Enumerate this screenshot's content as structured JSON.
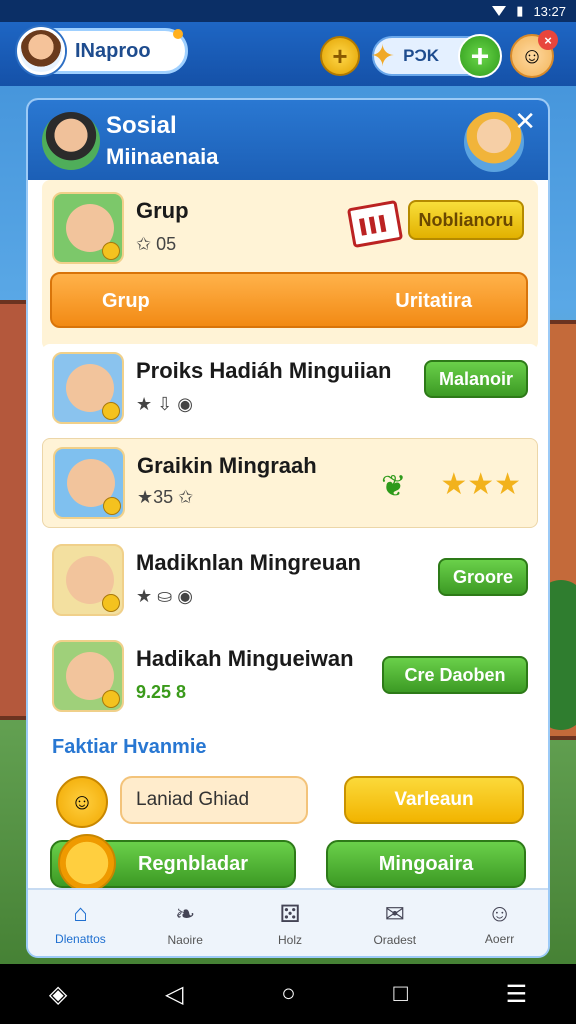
{
  "status": {
    "time": "13:27",
    "signal_icon": "signal-icon",
    "battery_icon": "battery-icon"
  },
  "topbar": {
    "profile_name": "INaproo",
    "currency_label": "PƆK",
    "coin_icon": "coin-plus-icon",
    "star_icon": "star-icon",
    "plus_icon": "plus-icon"
  },
  "panel": {
    "title": "Sosial",
    "subtitle": "Miinaenaia",
    "close_icon": "close-icon",
    "group": {
      "title": "Grup",
      "meta": "✩ 05",
      "button": "Noblianoru",
      "bar_left": "Grup",
      "bar_right": "Uritatira"
    },
    "rows": [
      {
        "title": "Proiks Hadiáh Minguiian",
        "meta": "★ ⇩ ◉",
        "button": "Malanoir"
      },
      {
        "title": "Graikin Mingraah",
        "meta": "★35 ✩",
        "badge": "★★★"
      },
      {
        "title": "Madiknlan Mingreuan",
        "meta": "★ ⛀ ◉",
        "button": "Groore"
      },
      {
        "title": "Hadikah Mingueiwan",
        "meta": "9.25 8",
        "button": "Cre Daoben"
      }
    ],
    "section_title": "Faktiar Hvanmie",
    "input_value": "Laniad Ghiad",
    "yellow_button": "Varleaun",
    "green_button_1": "Regnbladar",
    "green_button_2": "Mingoaira"
  },
  "tabs": [
    {
      "label": "Dlenattos",
      "icon": "home-icon"
    },
    {
      "label": "Naoire",
      "icon": "feather-icon"
    },
    {
      "label": "Holz",
      "icon": "dice-icon"
    },
    {
      "label": "Oradest",
      "icon": "mail-icon"
    },
    {
      "label": "Aoerr",
      "icon": "smile-icon"
    }
  ],
  "nav": [
    "◈",
    "◁",
    "○",
    "□",
    "☰"
  ]
}
